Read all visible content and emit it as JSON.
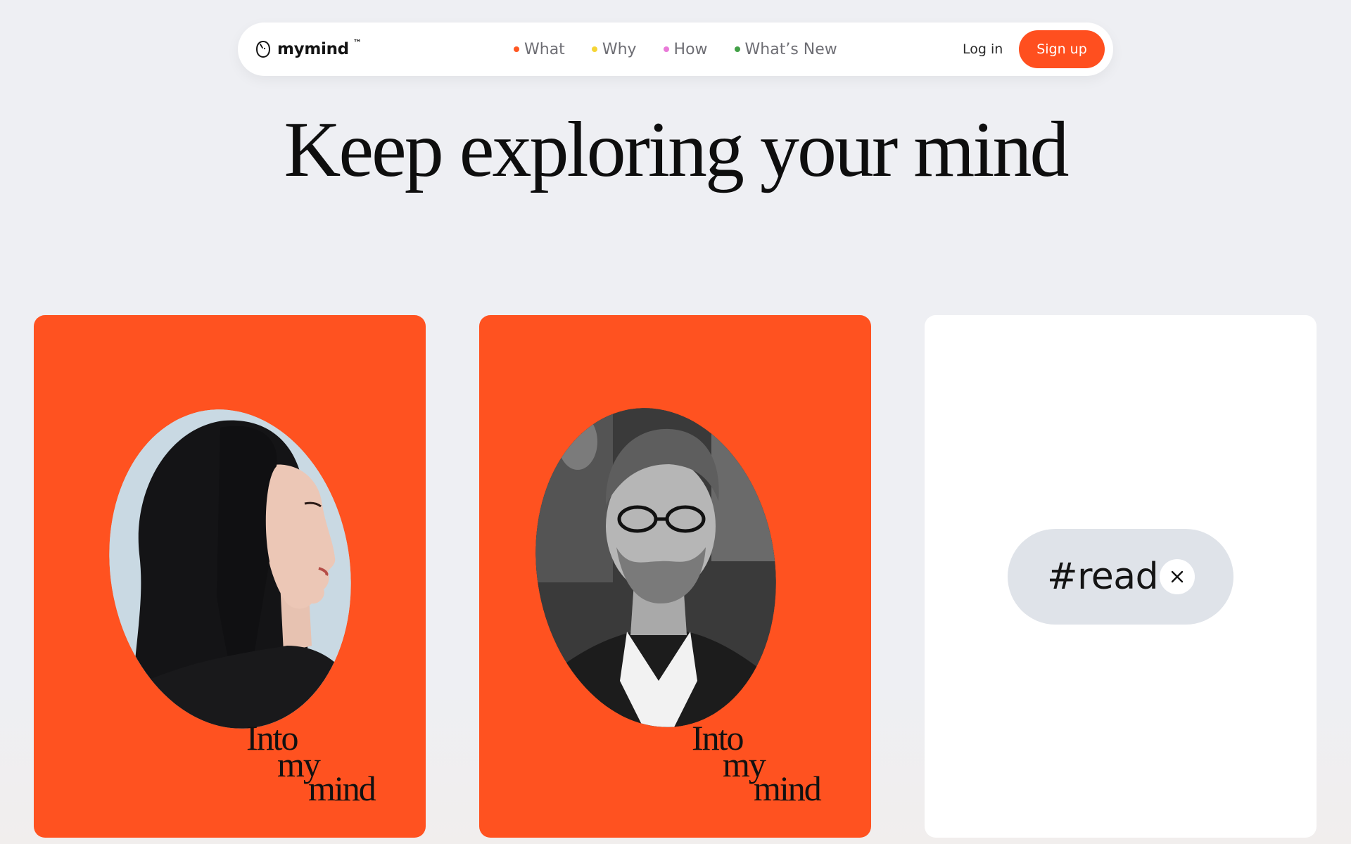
{
  "nav": {
    "brand": "mymind",
    "brand_tm": "™",
    "links": [
      {
        "label": "What",
        "dot_color": "#ff5722"
      },
      {
        "label": "Why",
        "dot_color": "#f5d536"
      },
      {
        "label": "How",
        "dot_color": "#e97ad8"
      },
      {
        "label": "What’s New",
        "dot_color": "#43a047"
      }
    ],
    "login": "Log in",
    "signup": "Sign up"
  },
  "hero": {
    "headline": "Keep exploring your mind"
  },
  "cards": [
    {
      "title_lines": [
        "Into",
        "my",
        "mind"
      ],
      "background": "#ff5220"
    },
    {
      "title_lines": [
        "Into",
        "my",
        "mind"
      ],
      "background": "#ff5220"
    },
    {
      "tag": "#read"
    }
  ],
  "colors": {
    "accent": "#ff4f1f",
    "page_bg": "#eeeff3",
    "tag_chip": "#dfe3e9"
  },
  "icons": {
    "brand": "mymind-logo-icon",
    "tag_remove": "close-icon"
  }
}
